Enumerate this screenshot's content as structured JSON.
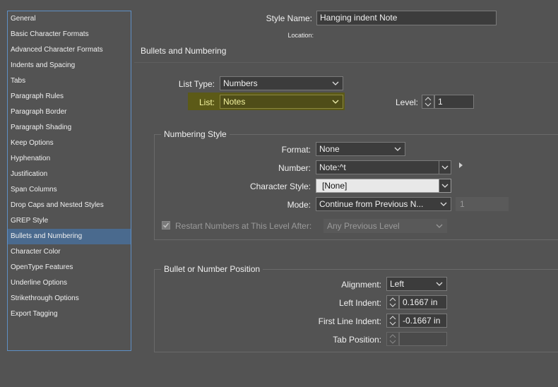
{
  "style_name": {
    "label": "Style Name:",
    "value": "Hanging indent Note"
  },
  "location": {
    "label": "Location:"
  },
  "page_title": "Bullets and Numbering",
  "sidebar": {
    "items": [
      {
        "label": "General"
      },
      {
        "label": "Basic Character Formats"
      },
      {
        "label": "Advanced Character Formats"
      },
      {
        "label": "Indents and Spacing"
      },
      {
        "label": "Tabs"
      },
      {
        "label": "Paragraph Rules"
      },
      {
        "label": "Paragraph Border"
      },
      {
        "label": "Paragraph Shading"
      },
      {
        "label": "Keep Options"
      },
      {
        "label": "Hyphenation"
      },
      {
        "label": "Justification"
      },
      {
        "label": "Span Columns"
      },
      {
        "label": "Drop Caps and Nested Styles"
      },
      {
        "label": "GREP Style"
      },
      {
        "label": "Bullets and Numbering"
      },
      {
        "label": "Character Color"
      },
      {
        "label": "OpenType Features"
      },
      {
        "label": "Underline Options"
      },
      {
        "label": "Strikethrough Options"
      },
      {
        "label": "Export Tagging"
      }
    ],
    "selected": "Bullets and Numbering"
  },
  "list_type": {
    "label": "List Type:",
    "value": "Numbers"
  },
  "list": {
    "label": "List:",
    "value": "Notes",
    "highlight_color": "#5c5a17"
  },
  "level": {
    "label": "Level:",
    "value": "1"
  },
  "numbering_style": {
    "title": "Numbering Style",
    "format": {
      "label": "Format:",
      "value": "None"
    },
    "number": {
      "label": "Number:",
      "value": "Note:^t"
    },
    "character_style": {
      "label": "Character Style:",
      "value": "[None]"
    },
    "mode": {
      "label": "Mode:",
      "value": "Continue from Previous N...",
      "start_value": "1"
    },
    "restart": {
      "label": "Restart Numbers at This Level After:",
      "value": "Any Previous Level",
      "checked": true
    }
  },
  "position": {
    "title": "Bullet or Number Position",
    "alignment": {
      "label": "Alignment:",
      "value": "Left"
    },
    "left_indent": {
      "label": "Left Indent:",
      "value": "0.1667 in"
    },
    "first_line_indent": {
      "label": "First Line Indent:",
      "value": "-0.1667 in"
    },
    "tab_position": {
      "label": "Tab Position:",
      "value": ""
    }
  },
  "colors": {
    "background": "#535353",
    "selection": "#4a6a8e",
    "sidebar_border": "#5e8fc4"
  }
}
